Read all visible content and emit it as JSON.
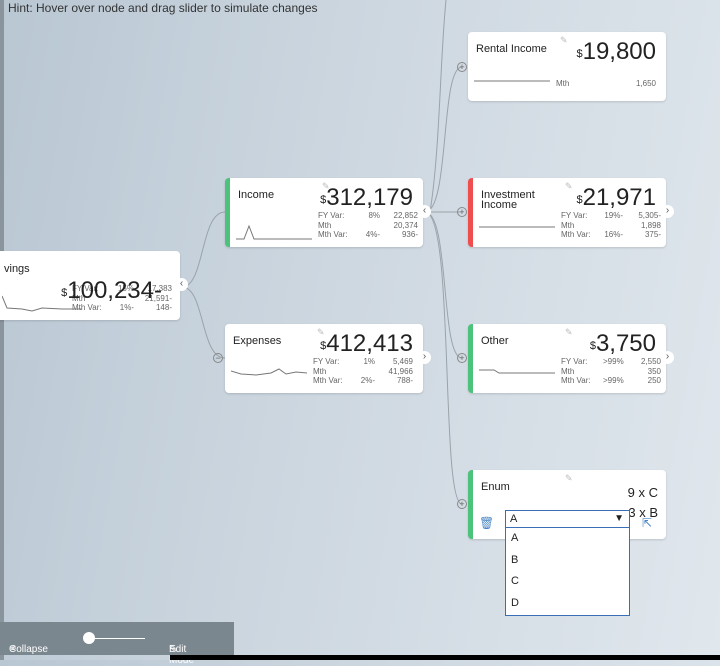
{
  "hint": "Hint: Hover over node and drag slider to simulate changes",
  "nodes": {
    "savings": {
      "title": "vings",
      "currency": "$",
      "value": "100,234-",
      "fy_label": "FY Var:",
      "fy_pct": "15%",
      "fy_val": "17,383",
      "mth_label": "Mth",
      "mth_val": "21,591-",
      "mv_label": "Mth Var:",
      "mv_pct": "1%-",
      "mv_val": "148-"
    },
    "income": {
      "title": "Income",
      "currency": "$",
      "value": "312,179",
      "fy_label": "FY Var:",
      "fy_pct": "8%",
      "fy_val": "22,852",
      "mth_label": "Mth",
      "mth_val": "20,374",
      "mv_label": "Mth Var:",
      "mv_pct": "4%-",
      "mv_val": "936-",
      "accent": "#4cc27a"
    },
    "expenses": {
      "title": "Expenses",
      "currency": "$",
      "value": "412,413",
      "fy_label": "FY Var:",
      "fy_pct": "1%",
      "fy_val": "5,469",
      "mth_label": "Mth",
      "mth_val": "41,966",
      "mv_label": "Mth Var:",
      "mv_pct": "2%-",
      "mv_val": "788-"
    },
    "rental": {
      "title": "Rental Income",
      "currency": "$",
      "value": "19,800",
      "mth_label": "Mth",
      "mth_val": "1,650"
    },
    "investment": {
      "title": "Investment Income",
      "currency": "$",
      "value": "21,971",
      "fy_label": "FY Var:",
      "fy_pct": "19%-",
      "fy_val": "5,305-",
      "mth_label": "Mth",
      "mth_val": "1,898",
      "mv_label": "Mth Var:",
      "mv_pct": "16%-",
      "mv_val": "375-",
      "accent": "#ef4e4e"
    },
    "other": {
      "title": "Other",
      "currency": "$",
      "value": "3,750",
      "fy_label": "FY Var:",
      "fy_pct": ">99%",
      "fy_val": "2,550",
      "mth_label": "Mth",
      "mth_val": "350",
      "mv_label": "Mth Var:",
      "mv_pct": ">99%",
      "mv_val": "250",
      "accent": "#4cc27a"
    },
    "enum": {
      "title": "Enum",
      "line1": "9 x C",
      "line2": "3 x B",
      "selected": "A",
      "options": [
        "A",
        "B",
        "C",
        "D"
      ],
      "accent": "#4cc27a"
    }
  },
  "footer": {
    "collapse": "Collapse",
    "edit_mode": "Edit Mode",
    "slider_value": 0
  }
}
